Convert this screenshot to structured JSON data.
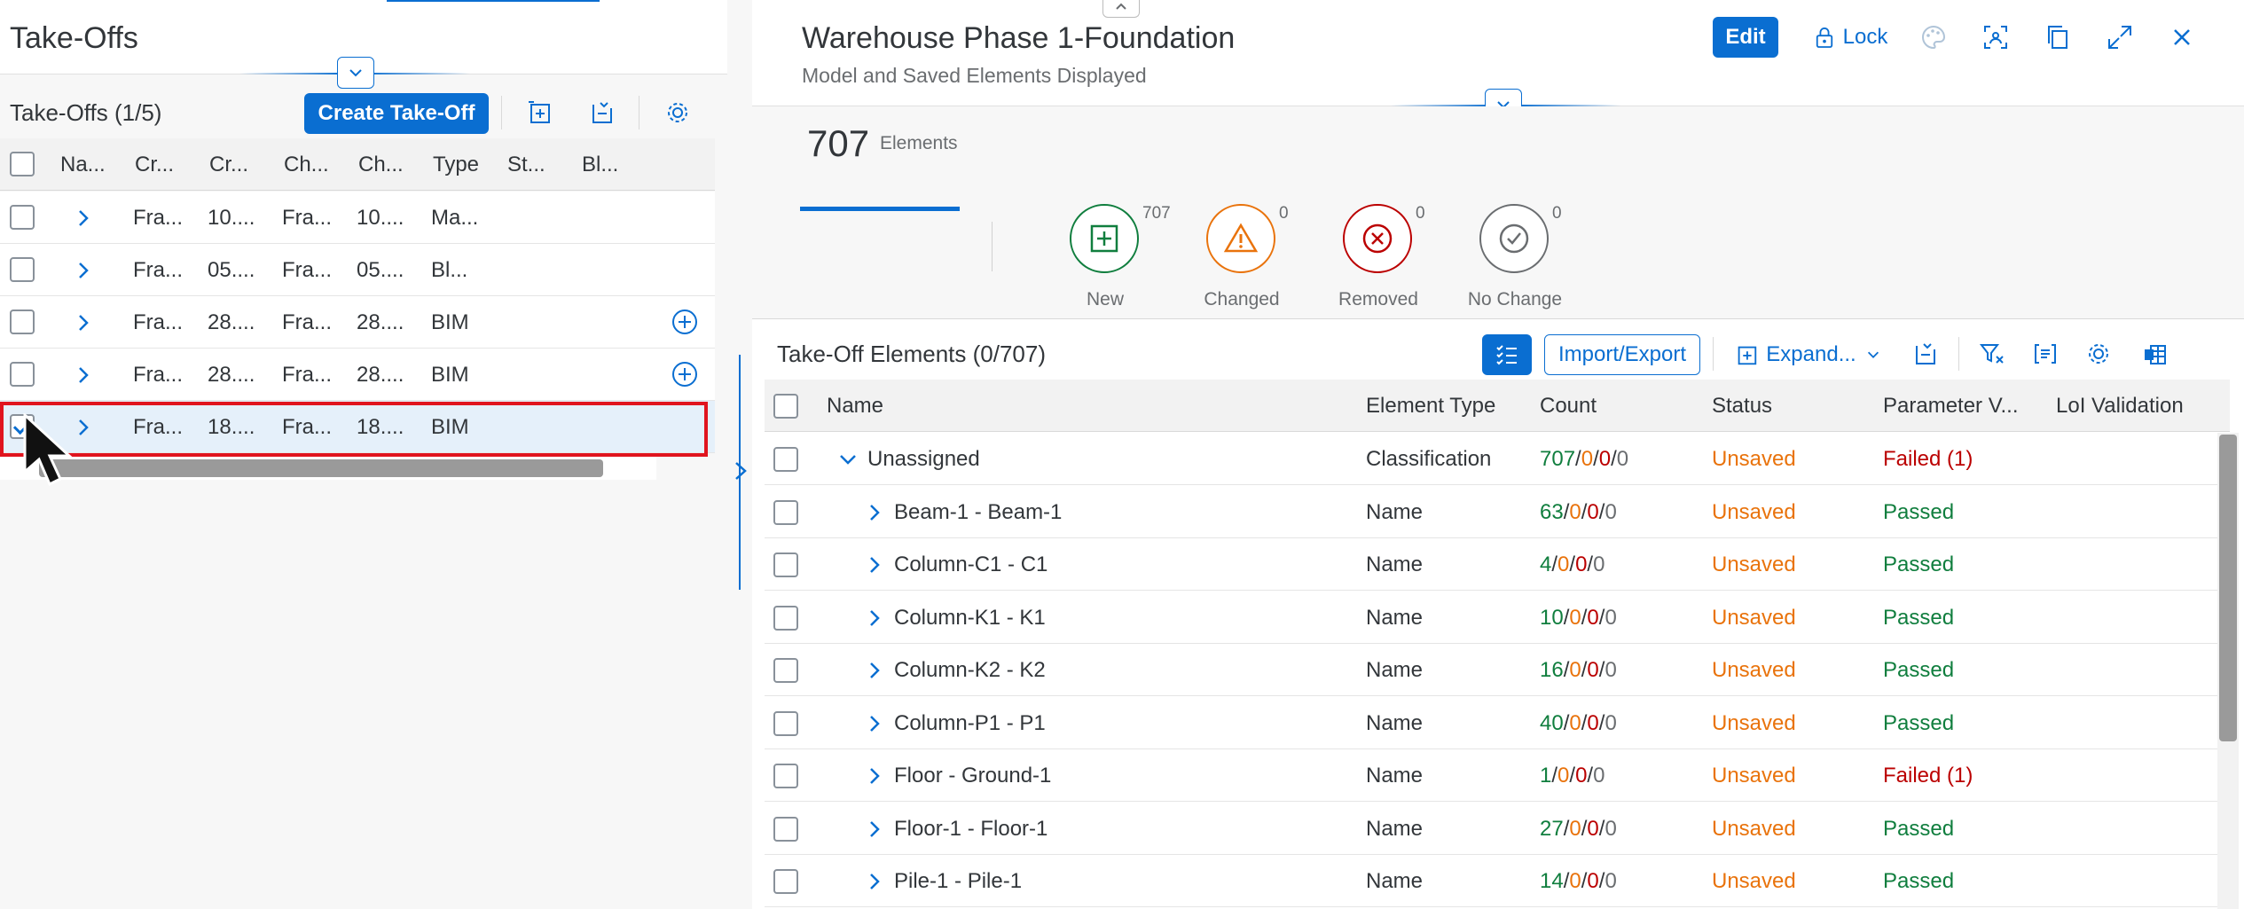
{
  "left": {
    "title": "Take-Offs",
    "toolbar_title": "Take-Offs (1/5)",
    "create_label": "Create Take-Off",
    "columns": [
      "Na...",
      "Cr...",
      "Cr...",
      "Ch...",
      "Ch...",
      "Type",
      "St...",
      "Bl..."
    ],
    "rows": [
      {
        "c1": "Fra...",
        "c2": "10....",
        "c3": "Fra...",
        "c4": "10....",
        "type": "Ma...",
        "selected": false,
        "add": false
      },
      {
        "c1": "Fra...",
        "c2": "05....",
        "c3": "Fra...",
        "c4": "05....",
        "type": "Bl...",
        "selected": false,
        "add": false
      },
      {
        "c1": "Fra...",
        "c2": "28....",
        "c3": "Fra...",
        "c4": "28....",
        "type": "BIM",
        "selected": false,
        "add": true
      },
      {
        "c1": "Fra...",
        "c2": "28....",
        "c3": "Fra...",
        "c4": "28....",
        "type": "BIM",
        "selected": false,
        "add": true
      },
      {
        "c1": "Fra...",
        "c2": "18....",
        "c3": "Fra...",
        "c4": "18....",
        "type": "BIM",
        "selected": true,
        "add": false
      }
    ]
  },
  "right": {
    "title": "Warehouse Phase 1-Foundation",
    "subtitle": "Model and Saved Elements Displayed",
    "edit_label": "Edit",
    "lock_label": "Lock",
    "total_count": "707",
    "total_label": "Elements",
    "kpis": [
      {
        "label": "New",
        "count": "707",
        "color": "#107e3e",
        "icon": "plus-square-icon"
      },
      {
        "label": "Changed",
        "count": "0",
        "color": "#e9730c",
        "icon": "warning-icon"
      },
      {
        "label": "Removed",
        "count": "0",
        "color": "#bb0000",
        "icon": "error-circle-icon"
      },
      {
        "label": "No Change",
        "count": "0",
        "color": "#6a6d70",
        "icon": "check-circle-icon"
      }
    ],
    "elements_title": "Take-Off Elements (0/707)",
    "import_export_label": "Import/Export",
    "expand_label": "Expand...",
    "columns": [
      "Name",
      "Element Type",
      "Count",
      "Status",
      "Parameter V...",
      "LoI Validation"
    ],
    "rows": [
      {
        "name": "Unassigned",
        "level": 0,
        "expanded": true,
        "type": "Classification",
        "count": [
          "707",
          "0",
          "0",
          "0"
        ],
        "status": "Unsaved",
        "param": "Failed (1)",
        "param_ok": false
      },
      {
        "name": "Beam-1 - Beam-1",
        "level": 1,
        "expanded": false,
        "type": "Name",
        "count": [
          "63",
          "0",
          "0",
          "0"
        ],
        "status": "Unsaved",
        "param": "Passed",
        "param_ok": true
      },
      {
        "name": "Column-C1 - C1",
        "level": 1,
        "expanded": false,
        "type": "Name",
        "count": [
          "4",
          "0",
          "0",
          "0"
        ],
        "status": "Unsaved",
        "param": "Passed",
        "param_ok": true
      },
      {
        "name": "Column-K1 - K1",
        "level": 1,
        "expanded": false,
        "type": "Name",
        "count": [
          "10",
          "0",
          "0",
          "0"
        ],
        "status": "Unsaved",
        "param": "Passed",
        "param_ok": true
      },
      {
        "name": "Column-K2 - K2",
        "level": 1,
        "expanded": false,
        "type": "Name",
        "count": [
          "16",
          "0",
          "0",
          "0"
        ],
        "status": "Unsaved",
        "param": "Passed",
        "param_ok": true
      },
      {
        "name": "Column-P1 - P1",
        "level": 1,
        "expanded": false,
        "type": "Name",
        "count": [
          "40",
          "0",
          "0",
          "0"
        ],
        "status": "Unsaved",
        "param": "Passed",
        "param_ok": true
      },
      {
        "name": "Floor - Ground-1",
        "level": 1,
        "expanded": false,
        "type": "Name",
        "count": [
          "1",
          "0",
          "0",
          "0"
        ],
        "status": "Unsaved",
        "param": "Failed (1)",
        "param_ok": false
      },
      {
        "name": "Floor-1 - Floor-1",
        "level": 1,
        "expanded": false,
        "type": "Name",
        "count": [
          "27",
          "0",
          "0",
          "0"
        ],
        "status": "Unsaved",
        "param": "Passed",
        "param_ok": true
      },
      {
        "name": "Pile-1 - Pile-1",
        "level": 1,
        "expanded": false,
        "type": "Name",
        "count": [
          "14",
          "0",
          "0",
          "0"
        ],
        "status": "Unsaved",
        "param": "Passed",
        "param_ok": true
      }
    ]
  },
  "colors": {
    "accent": "#0a6ed1",
    "selection_outline": "#e0141e",
    "positive": "#107e3e",
    "critical": "#e9730c",
    "negative": "#bb0000"
  }
}
